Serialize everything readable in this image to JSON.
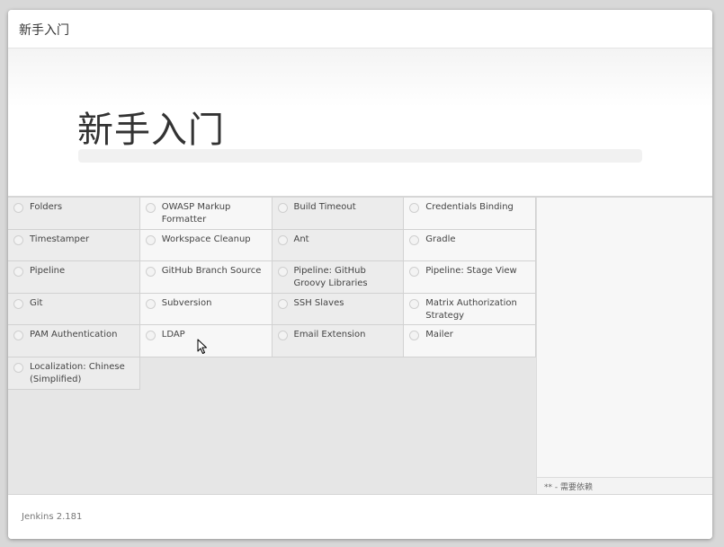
{
  "window": {
    "title": "新手入门"
  },
  "hero": {
    "heading": "新手入门",
    "progress_percent": 0
  },
  "plugins": [
    {
      "name": "Folders"
    },
    {
      "name": "OWASP Markup Formatter"
    },
    {
      "name": "Build Timeout"
    },
    {
      "name": "Credentials Binding"
    },
    {
      "name": "Timestamper"
    },
    {
      "name": "Workspace Cleanup"
    },
    {
      "name": "Ant"
    },
    {
      "name": "Gradle"
    },
    {
      "name": "Pipeline"
    },
    {
      "name": "GitHub Branch Source"
    },
    {
      "name": "Pipeline: GitHub Groovy Libraries"
    },
    {
      "name": "Pipeline: Stage View"
    },
    {
      "name": "Git"
    },
    {
      "name": "Subversion"
    },
    {
      "name": "SSH Slaves"
    },
    {
      "name": "Matrix Authorization Strategy"
    },
    {
      "name": "PAM Authentication"
    },
    {
      "name": "LDAP"
    },
    {
      "name": "Email Extension"
    },
    {
      "name": "Mailer"
    },
    {
      "name": "Localization: Chinese (Simplified)"
    }
  ],
  "dependencies": {
    "note": "** - 需要依赖"
  },
  "footer": {
    "version": "Jenkins 2.181"
  },
  "colors": {
    "progress": "#7cbb4e",
    "panel_bg": "#f7f7f7",
    "grid_bg": "#e6e6e6"
  }
}
